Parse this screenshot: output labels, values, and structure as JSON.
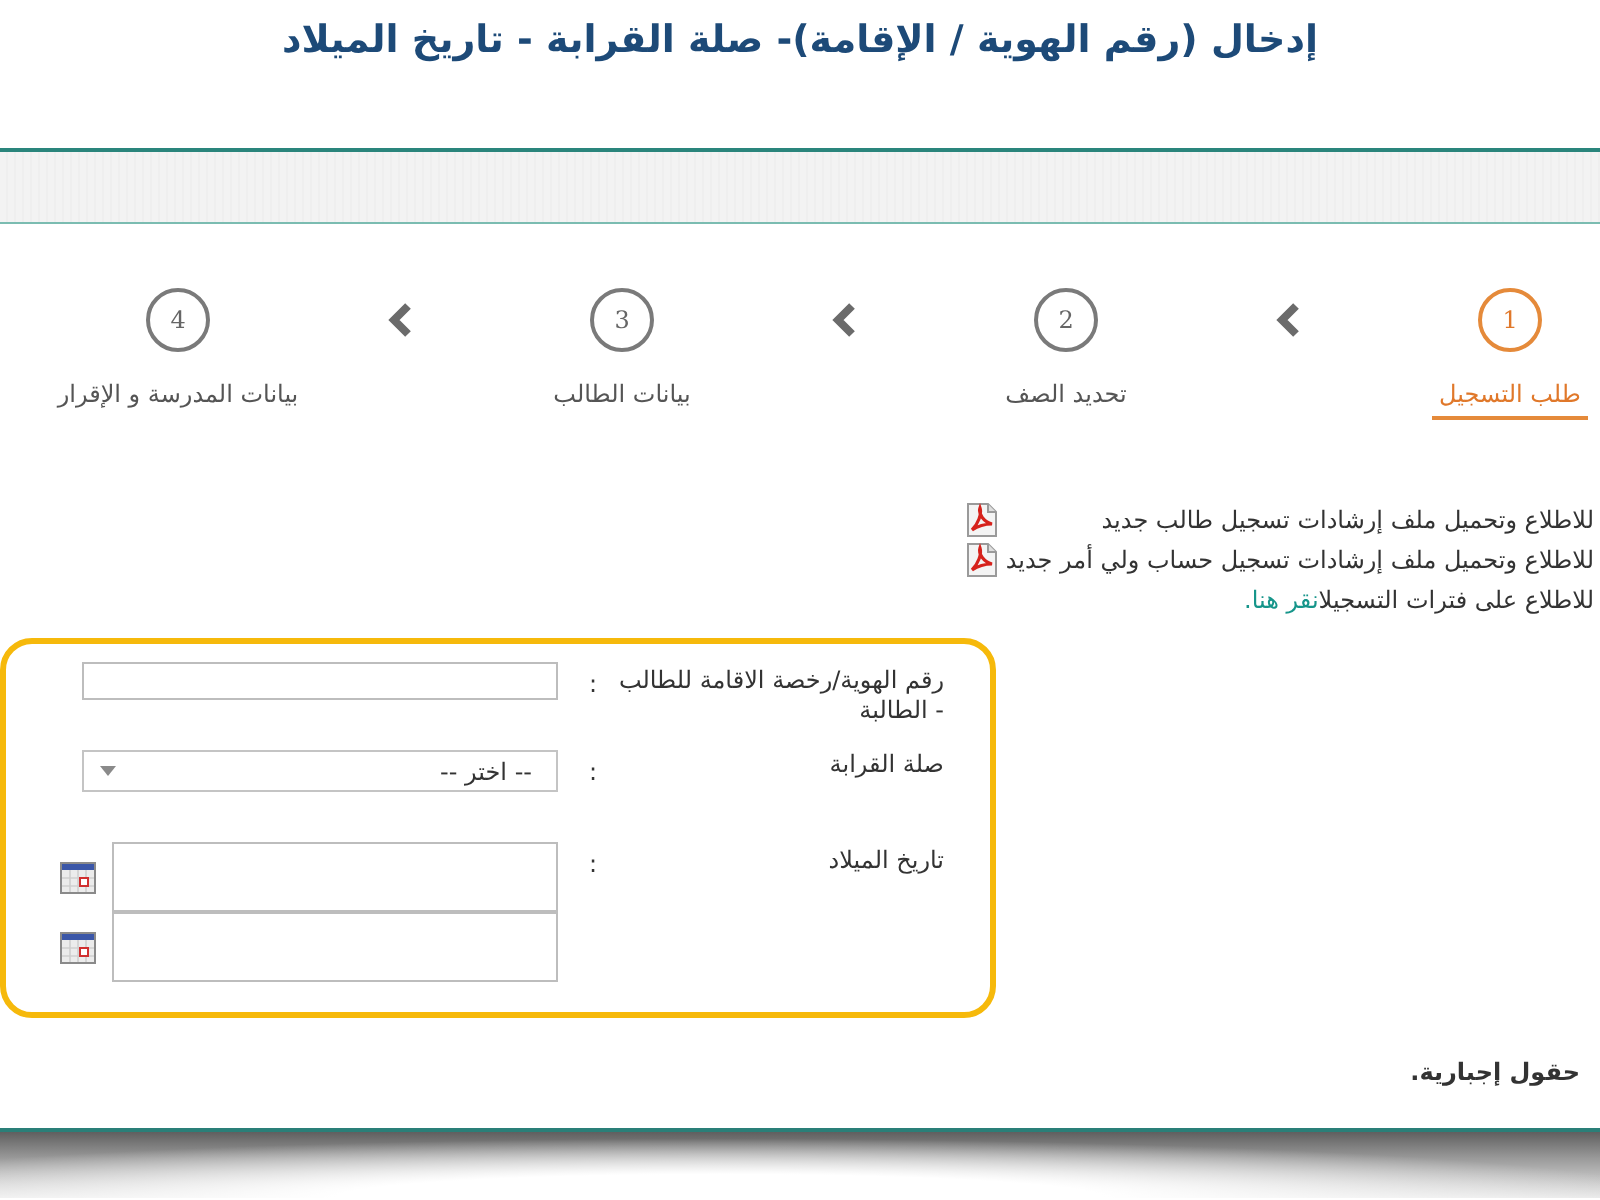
{
  "title": "إدخال (رقم الهوية / الإقامة)- صلة القرابة - تاريخ الميلاد",
  "steps": [
    {
      "number": "1",
      "label": "طلب التسجيل",
      "selected": true
    },
    {
      "number": "2",
      "label": "تحديد الصف",
      "selected": false
    },
    {
      "number": "3",
      "label": "بيانات الطالب",
      "selected": false
    },
    {
      "number": "4",
      "label": "بيانات المدرسة و الإقرار",
      "selected": false
    }
  ],
  "guides": [
    {
      "kind": "pdf",
      "text": "للاطلاع وتحميل ملف إرشادات تسجيل طالب جديد"
    },
    {
      "kind": "pdf",
      "text": "للاطلاع وتحميل ملف إرشادات تسجيل حساب ولي أمر جديد"
    },
    {
      "kind": "link",
      "text": "للاطلاع على فترات التسجيل",
      "link": "انقر هنا."
    }
  ],
  "form": {
    "fields": [
      {
        "kind": "text",
        "label": "رقم الهوية/رخصة الاقامة للطالب - الطالبة",
        "colon": ":"
      },
      {
        "kind": "select",
        "label": "صلة القرابة",
        "colon": ":",
        "value": "-- اختر --"
      },
      {
        "kind": "date_pair",
        "label": "تاريخ الميلاد",
        "colon": ":"
      }
    ]
  },
  "required_note": "حقول إجبارية."
}
